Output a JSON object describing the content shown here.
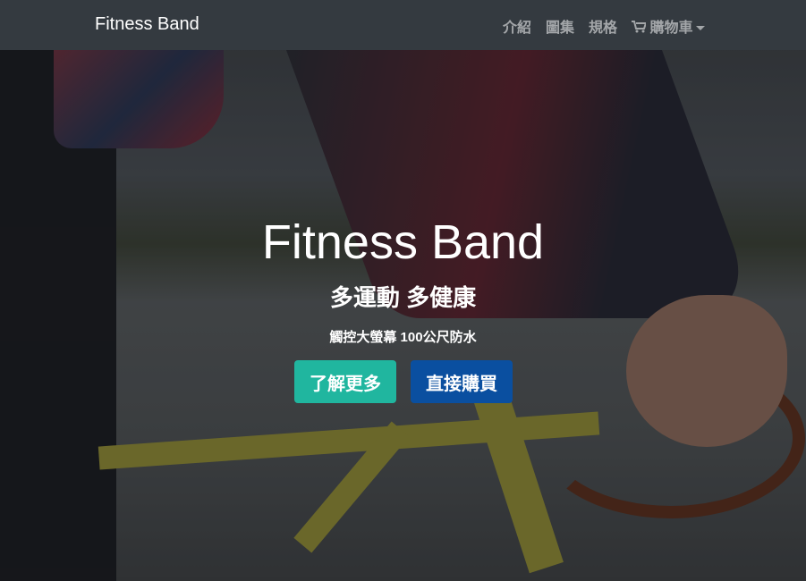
{
  "navbar": {
    "brand": "Fitness Band",
    "links": [
      {
        "label": "介紹"
      },
      {
        "label": "圖集"
      },
      {
        "label": "規格"
      },
      {
        "label": "購物車",
        "icon": "cart-icon",
        "dropdown": true
      }
    ]
  },
  "hero": {
    "title": "Fitness Band",
    "subtitle": "多運動 多健康",
    "tagline": "觸控大螢幕 100公尺防水",
    "buttons": [
      {
        "label": "了解更多",
        "color": "#20b69f"
      },
      {
        "label": "直接購買",
        "color": "#0a4fa0"
      }
    ]
  }
}
